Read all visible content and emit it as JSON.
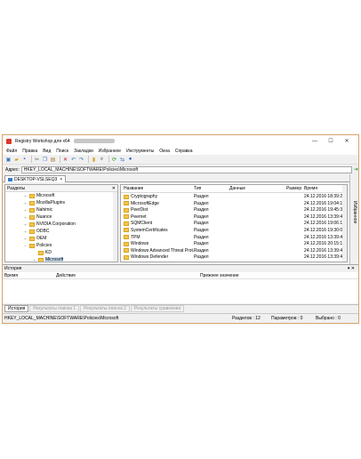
{
  "window": {
    "title": "Registry Workshop для x64",
    "buttons": {
      "minimize": "—",
      "maximize": "☐",
      "close": "✕"
    }
  },
  "menu": [
    "Файл",
    "Правка",
    "Вид",
    "Поиск",
    "Закладки",
    "Избранное",
    "Инструменты",
    "Окна",
    "Справка"
  ],
  "toolbar": {
    "icons": [
      "computer-icon",
      "open-icon",
      "save-icon",
      "cut-icon",
      "copy-icon",
      "paste-icon",
      "delete-icon",
      "undo-icon",
      "redo-icon",
      "new-key-icon",
      "new-value-icon",
      "find-icon",
      "bookmark-icon",
      "refresh-icon",
      "compare-icon",
      "help-icon"
    ]
  },
  "address": {
    "label": "Адрес:",
    "value": "HKEY_LOCAL_MACHINE\\SOFTWARE\\Policies\\Microsoft"
  },
  "host_tab": "DESKTOP-VSLSEQ3",
  "right_sidebar_label": "Избранное",
  "tree": {
    "header": "Разделы",
    "items": [
      {
        "label": "Microsoft",
        "expander": "+",
        "indent": 2
      },
      {
        "label": "MozillaPlugins",
        "expander": "+",
        "indent": 2
      },
      {
        "label": "Nahimic",
        "expander": "+",
        "indent": 2
      },
      {
        "label": "Nuance",
        "expander": "+",
        "indent": 2
      },
      {
        "label": "NVIDIA Corporation",
        "expander": "+",
        "indent": 2
      },
      {
        "label": "ODBC",
        "expander": "+",
        "indent": 2
      },
      {
        "label": "OEM",
        "expander": "+",
        "indent": 2
      },
      {
        "label": "Policies",
        "expander": "−",
        "indent": 2
      },
      {
        "label": "KD",
        "expander": "",
        "indent": 3
      },
      {
        "label": "Microsoft",
        "expander": "+",
        "indent": 3,
        "selected": true
      }
    ]
  },
  "list": {
    "columns": {
      "name": "Название",
      "type": "Тип",
      "data": "Данные",
      "size": "Размер",
      "time": "Время"
    },
    "rows": [
      {
        "name": "Cryptography",
        "type": "Раздел",
        "time": "24.12.2016 18:39:22"
      },
      {
        "name": "MicrosoftEdge",
        "type": "Раздел",
        "time": "24.12.2016 19:04:16"
      },
      {
        "name": "PeerDist",
        "type": "Раздел",
        "time": "24.12.2016 19:45:34"
      },
      {
        "name": "Peernet",
        "type": "Раздел",
        "time": "24.12.2016 13:39:48"
      },
      {
        "name": "SQMClient",
        "type": "Раздел",
        "time": "24.12.2016 19:06:19"
      },
      {
        "name": "SystemCertificates",
        "type": "Раздел",
        "time": "24.12.2016 19:30:01"
      },
      {
        "name": "TPM",
        "type": "Раздел",
        "time": "24.12.2016 13:39:48"
      },
      {
        "name": "Windows",
        "type": "Раздел",
        "time": "24.12.2016 20:15:13"
      },
      {
        "name": "Windows Advanced Threat Prot...",
        "type": "Раздел",
        "time": "24.12.2016 13:39:48"
      },
      {
        "name": "Windows Defender",
        "type": "Раздел",
        "time": "24.12.2016 13:39:48"
      }
    ]
  },
  "history": {
    "title": "История",
    "pin": "▾ ✕",
    "columns": {
      "time": "Время",
      "action": "Действие",
      "previous": "Прежнее значение"
    }
  },
  "bottom_tabs": [
    {
      "label": "История",
      "active": true
    },
    {
      "label": "Результаты поиска 1",
      "active": false
    },
    {
      "label": "Результаты поиска 2",
      "active": false
    },
    {
      "label": "Результаты сравнения",
      "active": false
    }
  ],
  "status": {
    "path": "HKEY_LOCAL_MACHINE\\SOFTWARE\\Policies\\Microsoft",
    "sections": "Разделов : 12",
    "params": "Параметров : 0",
    "selected": "Выбрано : 0"
  }
}
